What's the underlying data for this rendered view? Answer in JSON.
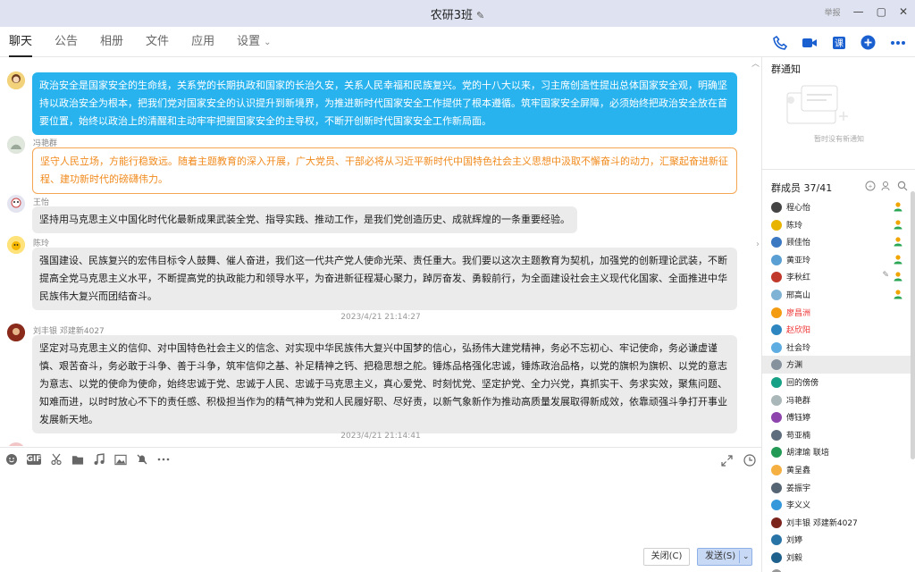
{
  "window": {
    "title": "农研3班",
    "controls": [
      "举报",
      "—",
      "▢",
      "✕"
    ]
  },
  "tabs": [
    {
      "label": "聊天",
      "active": true
    },
    {
      "label": "公告"
    },
    {
      "label": "相册"
    },
    {
      "label": "文件"
    },
    {
      "label": "应用"
    },
    {
      "label": "设置"
    }
  ],
  "toolbar_icons": [
    "phone-icon",
    "video-icon",
    "class-icon",
    "add-icon",
    "more-icon"
  ],
  "messages": [
    {
      "sender": "",
      "style": "blue",
      "text": "政治安全是国家安全的生命线，关系党的长期执政和国家的长治久安，关系人民幸福和民族复兴。党的十八大以来，习主席创造性提出总体国家安全观，明确坚持以政治安全为根本，把我们党对国家安全的认识提升到新境界，为推进新时代国家安全工作提供了根本遵循。筑牢国家安全屏障，必须始终把政治安全放在首要位置，始终以政治上的清醒和主动牢牢把握国家安全的主导权，不断开创新时代国家安全工作新局面。"
    },
    {
      "sender": "冯艳群",
      "style": "orange",
      "text": "坚守人民立场，方能行稳致远。随着主题教育的深入开展，广大党员、干部必将从习近平新时代中国特色社会主义思想中汲取不懈奋斗的动力，汇聚起奋进新征程、建功新时代的磅礴伟力。"
    },
    {
      "sender": "王怡",
      "style": "grey",
      "text": "坚持用马克思主义中国化时代化最新成果武装全党、指导实践、推动工作，是我们党创造历史、成就辉煌的一条重要经验。"
    },
    {
      "sender": "陈玲",
      "style": "grey",
      "text": "强国建设、民族复兴的宏伟目标令人鼓舞、催人奋进，我们这一代共产党人使命光荣、责任重大。我们要以这次主题教育为契机，加强党的创新理论武装，不断提高全党马克思主义水平，不断提高党的执政能力和领导水平，为奋进新征程凝心聚力，踔厉奋发、勇毅前行，为全面建设社会主义现代化国家、全面推进中华民族伟大复兴而团结奋斗。"
    },
    {
      "timestamp": "2023/4/21 21:14:27"
    },
    {
      "sender": "刘丰银 邓建新4027",
      "style": "grey",
      "text": "坚定对马克思主义的信仰、对中国特色社会主义的信念、对实现中华民族伟大复兴中国梦的信心，弘扬伟大建党精神，务必不忘初心、牢记使命，务必谦虚谨慎、艰苦奋斗，务必敢于斗争、善于斗争，筑牢信仰之基、补足精神之钙、把稳思想之舵。锤炼品格强化忠诚，锤炼政治品格，以党的旗帜为旗帜、以党的意志为意志、以党的使命为使命，始终忠诚于党、忠诚于人民、忠诚于马克思主义，真心爱党、时刻忧党、坚定护党、全力兴党，真抓实干、务求实效，聚焦问题、知难而进，以时时放心不下的责任感、积极担当作为的精气神为党和人民履好职、尽好责，以新气象新作为推动高质量发展取得新成效，依靠顽强斗争打开事业发展新天地。"
    },
    {
      "timestamp": "2023/4/21 21:14:41"
    }
  ],
  "compose": {
    "tools": [
      "emoji-icon",
      "GIF",
      "scissors-icon",
      "folder-icon",
      "music-icon",
      "image-icon",
      "bell-off-icon",
      "more-icon"
    ],
    "placeholder": "",
    "close_label": "关闭(C)",
    "send_label": "发送(S)"
  },
  "right_panel": {
    "notice_title": "群通知",
    "notice_empty": "暂时没有新通知",
    "members_title": "群成员 37/41",
    "members": [
      {
        "name": "程心怡",
        "color": "#444444",
        "badge": true
      },
      {
        "name": "陈玲",
        "color": "#e8b400",
        "badge": true
      },
      {
        "name": "顾佳怡",
        "color": "#3a78c2",
        "badge": true
      },
      {
        "name": "黄亚玲",
        "color": "#5a9fd4",
        "badge": true
      },
      {
        "name": "李秋红",
        "color": "#c0392b",
        "badge": true,
        "edit": true
      },
      {
        "name": "邢高山",
        "color": "#7fb3d5",
        "badge": true
      },
      {
        "name": "廖昌洲",
        "color": "#f39c12",
        "red": true
      },
      {
        "name": "赵欣阳",
        "color": "#2e86c1",
        "red": true
      },
      {
        "name": "社会玲",
        "color": "#5dade2"
      },
      {
        "name": "方渊",
        "color": "#85929e",
        "highlight": true
      },
      {
        "name": "回的傍傍",
        "color": "#16a085"
      },
      {
        "name": "冯艳群",
        "color": "#aab7b8"
      },
      {
        "name": "傅钰婷",
        "color": "#8e44ad"
      },
      {
        "name": "苟亚楠",
        "color": "#5d6d7e"
      },
      {
        "name": "胡津瑜 联培",
        "color": "#229954"
      },
      {
        "name": "黄呈鑫",
        "color": "#f5b041"
      },
      {
        "name": "姜振宇",
        "color": "#566573"
      },
      {
        "name": "李义义",
        "color": "#3498db"
      },
      {
        "name": "刘丰银 邓建新4027",
        "color": "#7b241c"
      },
      {
        "name": "刘婷",
        "color": "#2874a6"
      },
      {
        "name": "刘毅",
        "color": "#1f618d"
      },
      {
        "name": "…",
        "color": "#999999"
      }
    ]
  }
}
